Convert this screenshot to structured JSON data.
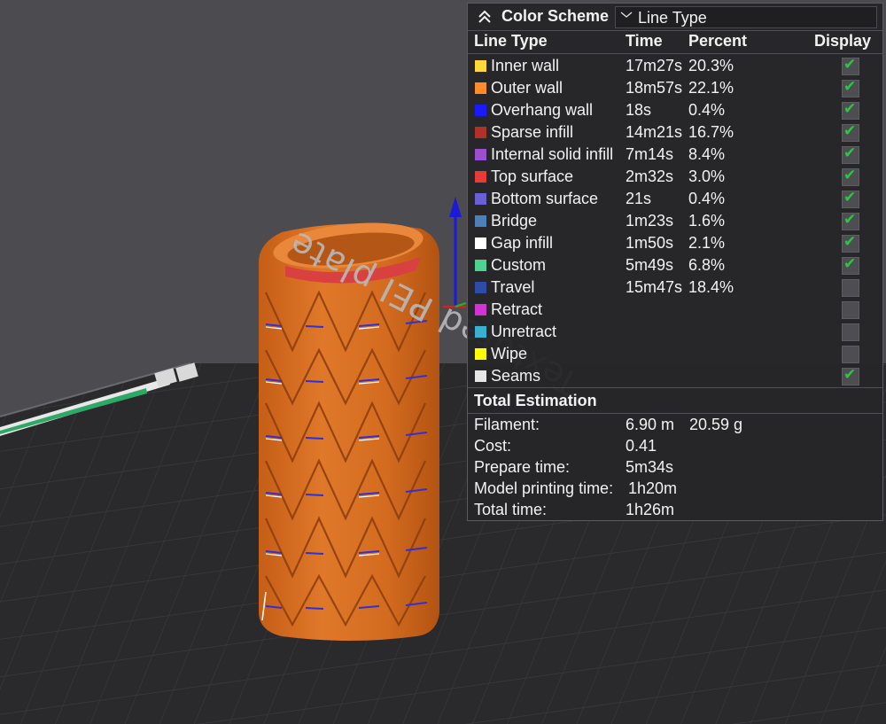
{
  "viewport": {
    "plate_label": "Textured PEI plate"
  },
  "legend": {
    "title": "Color Scheme",
    "scheme_select": "Line Type",
    "columns": [
      "Line Type",
      "Time",
      "Percent",
      "Display"
    ],
    "rows": [
      {
        "name": "Inner wall",
        "time": "17m27s",
        "percent": "20.3%",
        "color": "#ffd939",
        "display": true
      },
      {
        "name": "Outer wall",
        "time": "18m57s",
        "percent": "22.1%",
        "color": "#ff8c26",
        "display": true
      },
      {
        "name": "Overhang wall",
        "time": "18s",
        "percent": "0.4%",
        "color": "#1a1aff",
        "display": true
      },
      {
        "name": "Sparse infill",
        "time": "14m21s",
        "percent": "16.7%",
        "color": "#b0302a",
        "display": true
      },
      {
        "name": "Internal solid infill",
        "time": "7m14s",
        "percent": "8.4%",
        "color": "#9a4fd0",
        "display": true
      },
      {
        "name": "Top surface",
        "time": "2m32s",
        "percent": "3.0%",
        "color": "#e83a3a",
        "display": true
      },
      {
        "name": "Bottom surface",
        "time": "21s",
        "percent": "0.4%",
        "color": "#6b5fd6",
        "display": true
      },
      {
        "name": "Bridge",
        "time": "1m23s",
        "percent": "1.6%",
        "color": "#4d80ba",
        "display": true
      },
      {
        "name": "Gap infill",
        "time": "1m50s",
        "percent": "2.1%",
        "color": "#ffffff",
        "display": true
      },
      {
        "name": "Custom",
        "time": "5m49s",
        "percent": "6.8%",
        "color": "#4fd18f",
        "display": true
      },
      {
        "name": "Travel",
        "time": "15m47s",
        "percent": "18.4%",
        "color": "#2f4aa8",
        "display": false
      },
      {
        "name": "Retract",
        "time": "",
        "percent": "",
        "color": "#d433d4",
        "display": false
      },
      {
        "name": "Unretract",
        "time": "",
        "percent": "",
        "color": "#3ab0d1",
        "display": false
      },
      {
        "name": "Wipe",
        "time": "",
        "percent": "",
        "color": "#ffff00",
        "display": false
      },
      {
        "name": "Seams",
        "time": "",
        "percent": "",
        "color": "#e6e6e6",
        "display": true
      }
    ],
    "estimation": {
      "title": "Total Estimation",
      "filament_label": "Filament:",
      "filament_length": "6.90 m",
      "filament_weight": "20.59 g",
      "cost_label": "Cost:",
      "cost": "0.41",
      "prepare_label": "Prepare time:",
      "prepare": "5m34s",
      "model_label": "Model printing time:",
      "model": "1h20m",
      "total_label": "Total time:",
      "total": "1h26m"
    }
  }
}
